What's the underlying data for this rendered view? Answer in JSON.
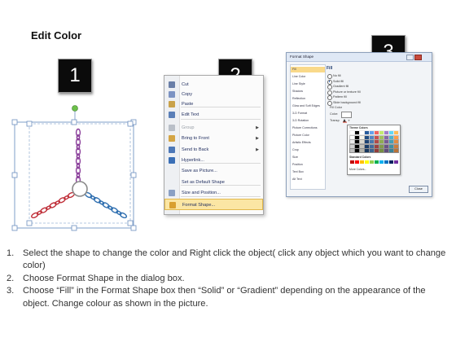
{
  "title": "Edit Color",
  "badges": [
    "1",
    "2",
    "3"
  ],
  "context_menu": {
    "items": [
      {
        "label": "Cut",
        "icon": "scissors-icon",
        "color": "#6a7fa8"
      },
      {
        "label": "Copy",
        "icon": "copy-icon",
        "color": "#7c93c3"
      },
      {
        "label": "Paste",
        "icon": "paste-icon",
        "color": "#c9a24a"
      },
      {
        "label": "Edit Text",
        "icon": "edit-text-icon",
        "color": "#5a7fb8"
      },
      {
        "label": "Group",
        "icon": "group-icon",
        "color": "#b9bfc8",
        "disabled": true,
        "submenu": true
      },
      {
        "label": "Bring to Front",
        "icon": "bring-front-icon",
        "color": "#d4a545",
        "submenu": true
      },
      {
        "label": "Send to Back",
        "icon": "send-back-icon",
        "color": "#4d78b8",
        "submenu": true
      },
      {
        "label": "Hyperlink...",
        "icon": "hyperlink-icon",
        "color": "#3b6fb6"
      },
      {
        "label": "Save as Picture...",
        "icon": "",
        "color": ""
      },
      {
        "label": "Set as Default Shape",
        "icon": "",
        "color": ""
      },
      {
        "label": "Size and Position...",
        "icon": "size-position-icon",
        "color": "#8aa0c4"
      },
      {
        "label": "Format Shape...",
        "icon": "format-shape-icon",
        "color": "#d9a030",
        "highlight": true
      }
    ]
  },
  "dialog": {
    "title": "Format Shape",
    "nav": [
      "Fill",
      "Line Color",
      "Line Style",
      "Shadow",
      "Reflection",
      "Glow and Soft Edges",
      "3-D Format",
      "3-D Rotation",
      "Picture Corrections",
      "Picture Color",
      "Artistic Effects",
      "Crop",
      "Size",
      "Position",
      "Text Box",
      "Alt Text"
    ],
    "fill_heading": "Fill",
    "options": [
      {
        "label": "No fill",
        "on": false
      },
      {
        "label": "Solid fill",
        "on": true
      },
      {
        "label": "Gradient fill",
        "on": false
      },
      {
        "label": "Picture or texture fill",
        "on": false
      },
      {
        "label": "Pattern fill",
        "on": false
      },
      {
        "label": "Slide background fill",
        "on": false
      }
    ],
    "fill_color_label": "Fill Color",
    "color_label": "Color:",
    "transparency_label": "Transp",
    "theme_colors_label": "Theme Colors",
    "standard_colors_label": "Standard Colors",
    "more_colors_label": "More Colors...",
    "close_label": "Close"
  },
  "instructions": [
    {
      "num": "1.",
      "text": "Select the shape to change the color and Right click the object( click any object which you want to change color)"
    },
    {
      "num": "2.",
      "text": "Choose Format Shape in the dialog box."
    },
    {
      "num": "3.",
      "text": "Choose “Fill” in the Format Shape box then “Solid” or “Gradient” depending on the appearance of the object. Change colour as shown in the picture."
    }
  ],
  "colors": {
    "chain_purple": "#8a3e9a",
    "chain_red": "#c0303a",
    "chain_blue": "#2f6fb0",
    "menu_highlight": "#fbe6a4",
    "handle_green": "#6cc04a"
  }
}
